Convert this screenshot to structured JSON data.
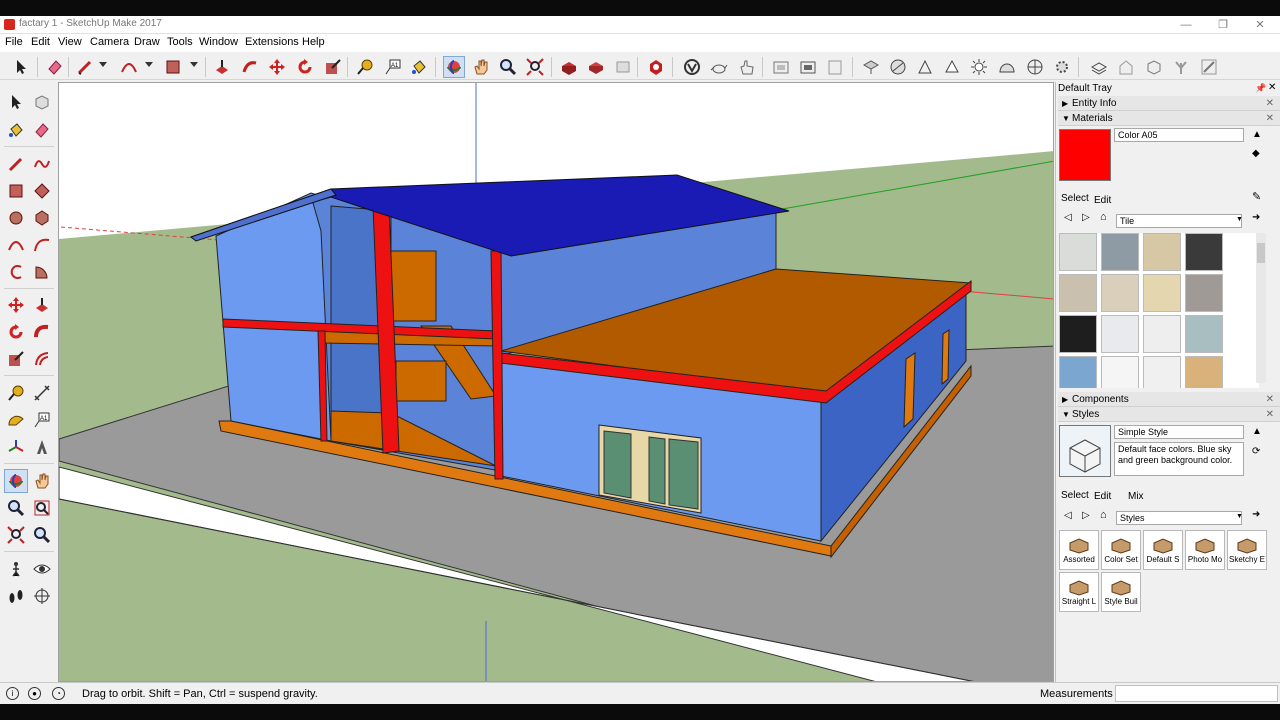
{
  "window": {
    "title": "factary 1 - SketchUp Make 2017",
    "controls": [
      "—",
      "❐",
      "✕"
    ]
  },
  "menu": [
    "File",
    "Edit",
    "View",
    "Camera",
    "Draw",
    "Tools",
    "Window",
    "Extensions",
    "Help"
  ],
  "tray": {
    "title": "Default Tray",
    "entity_info": "Entity Info",
    "materials": {
      "title": "Materials",
      "name": "Color A05",
      "color": "#ff0000",
      "tab_select": "Select",
      "tab_edit": "Edit",
      "library": "Tile",
      "swatches": [
        "#d9dcd9",
        "#8e9ba4",
        "#d6c8a4",
        "#3a3a3a",
        "#c9c1ae",
        "#d9cfba",
        "#e4d6ae",
        "#a09a96",
        "#1e1e1e",
        "#e8eaed",
        "#eeeeee",
        "#a9bec0",
        "#7aa6cf",
        "#f5f5f5",
        "#f0f0f0",
        "#d8b27a"
      ]
    },
    "components": {
      "title": "Components"
    },
    "styles": {
      "title": "Styles",
      "name": "Simple Style",
      "description": "Default face colors. Blue sky and green background color.",
      "tab_select": "Select",
      "tab_edit": "Edit",
      "tab_mix": "Mix",
      "library": "Styles",
      "folders": [
        "Assorted",
        "Color Set",
        "Default S",
        "Photo Mo",
        "Sketchy E",
        "Straight L",
        "Style Buil"
      ]
    }
  },
  "status": {
    "message": "Drag to orbit. Shift = Pan, Ctrl = suspend gravity.",
    "measurements_label": "Measurements",
    "measurements_value": ""
  },
  "colors": {
    "sky": "#ffffff",
    "ground": "#a2ba8c",
    "platform": "#9a9a9a",
    "wall": "#6b9af0",
    "roof": "#1a1ab4",
    "beams": "#ee1111",
    "floor": "#cc6a00"
  }
}
